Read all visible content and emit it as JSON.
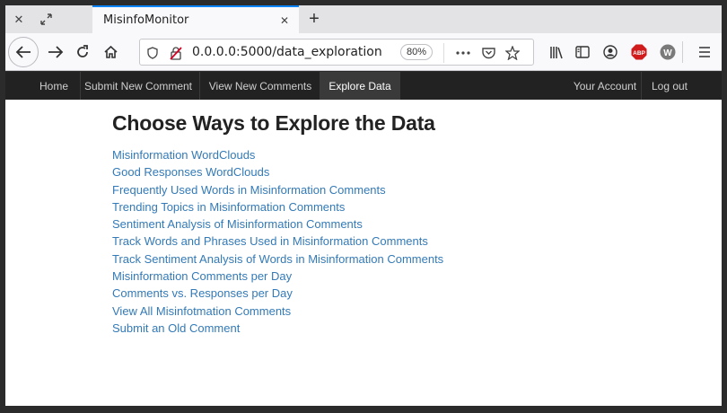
{
  "browser": {
    "tab_title": "MisinfoMonitor",
    "url": "0.0.0.0:5000/data_exploration",
    "zoom": "80%",
    "adblock_label": "ABP",
    "extension_label": "W"
  },
  "site_nav": {
    "items": [
      {
        "label": "Home"
      },
      {
        "label": "Submit New Comment"
      },
      {
        "label": "View New Comments"
      },
      {
        "label": "Explore Data"
      }
    ],
    "right_items": [
      {
        "label": "Your Account"
      },
      {
        "label": "Log out"
      }
    ]
  },
  "main": {
    "title": "Choose Ways to Explore the Data",
    "links": [
      {
        "label": "Misinformation WordClouds"
      },
      {
        "label": "Good Responses WordClouds"
      },
      {
        "label": "Frequently Used Words in Misinformation Comments"
      },
      {
        "label": "Trending Topics in Misinformation Comments"
      },
      {
        "label": "Sentiment Analysis of Misinformation Comments"
      },
      {
        "label": "Track Words and Phrases Used in Misinformation Comments"
      },
      {
        "label": "Track Sentiment Analysis of Words in Misinformation Comments"
      },
      {
        "label": "Misinformation Comments per Day"
      },
      {
        "label": "Comments vs. Responses per Day"
      },
      {
        "label": "View All Misinfotmation Comments"
      },
      {
        "label": "Submit an Old Comment"
      }
    ]
  },
  "colors": {
    "link": "#337ab7",
    "navbar_bg": "#222222",
    "tab_accent": "#0a84ff"
  }
}
